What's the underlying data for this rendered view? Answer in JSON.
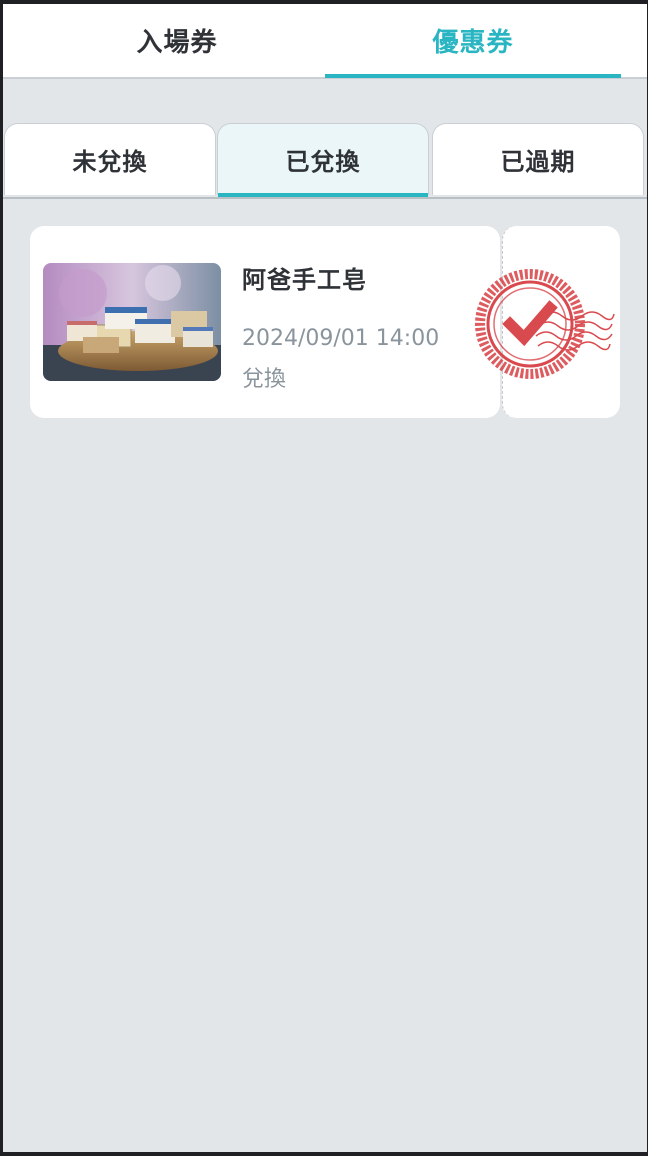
{
  "top_tabs": {
    "tab1_label": "入場券",
    "tab2_label": "優惠券",
    "active": "tab2"
  },
  "sub_tabs": {
    "tab1_label": "未兌換",
    "tab2_label": "已兌換",
    "tab3_label": "已過期",
    "active": "tab2"
  },
  "coupon": {
    "title": "阿爸手工皂",
    "datetime": "2024/09/01 14:00",
    "status": "兌換",
    "image": "handmade-soap-photo",
    "stamp": "redeemed-check-stamp-icon"
  },
  "colors": {
    "accent": "#2ab5c3",
    "background": "#e2e6e9",
    "stamp_red": "#d94a4f",
    "text_dark": "#2f3337",
    "text_muted": "#8a949c"
  }
}
